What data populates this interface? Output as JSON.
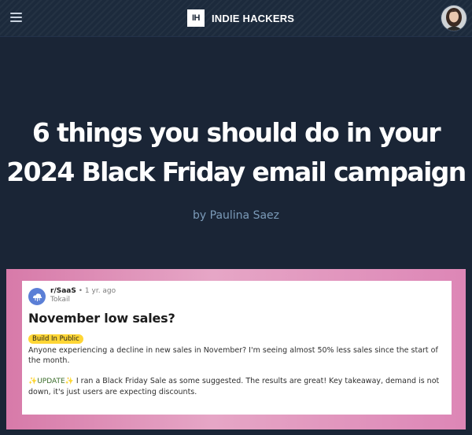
{
  "header": {
    "menu_icon": "hamburger-menu-icon",
    "logo_text": "IH",
    "brand_name": "INDIE HACKERS",
    "avatar_icon": "user-avatar"
  },
  "article": {
    "title_line_1": "6 things you should do in your",
    "title_line_2": "2024 Black Friday email campaign",
    "byline_prefix": "by",
    "author": "Paulina Saez"
  },
  "embedded_post": {
    "subreddit": "r/SaaS",
    "separator": "•",
    "age": "1 yr. ago",
    "username": "Tokail",
    "title": "November low sales?",
    "flair": "Build In Public",
    "body": "Anyone experiencing a decline in new sales in November? I'm seeing almost 50% less sales since the start of the month.",
    "update_prefix": "✨UPDATE✨",
    "update_text": " I ran a Black Friday Sale as some suggested. The results are great! Key takeaway, demand is not down, it's just users are expecting discounts."
  },
  "colors": {
    "page_background": "#1a2536",
    "byline": "#7b9ab8",
    "image_frame_pink": "#d77aa9",
    "flair_yellow": "#ffd635"
  }
}
